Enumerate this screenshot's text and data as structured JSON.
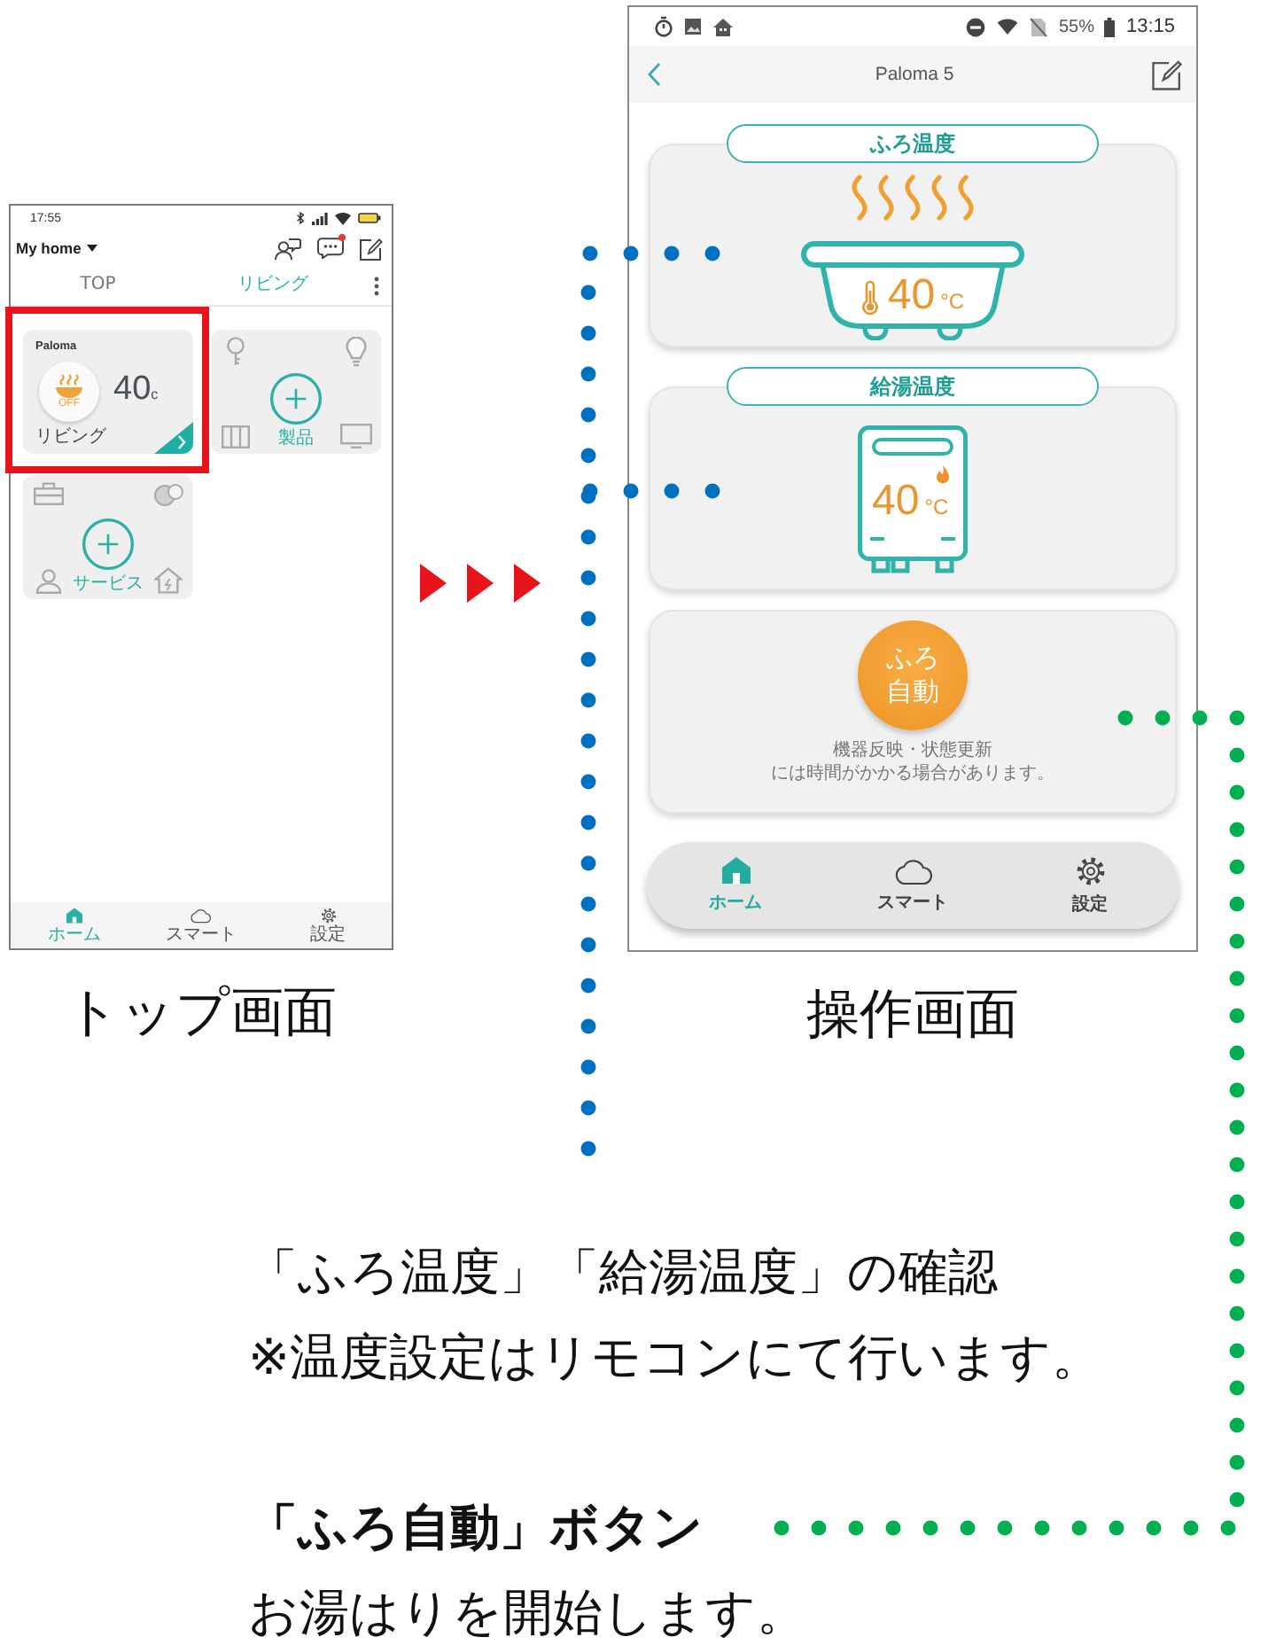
{
  "top_screen": {
    "status_bar": {
      "time": "17:55"
    },
    "header": {
      "home_name": "My home"
    },
    "tabs": [
      {
        "label": "TOP",
        "selected": false
      },
      {
        "label": "リビング",
        "selected": true
      }
    ],
    "cards": [
      {
        "kind": "device",
        "name": "Paloma",
        "state": "OFF",
        "temperature": "40",
        "unit": "c",
        "room": "リビング",
        "highlighted": true
      },
      {
        "kind": "products",
        "label": "製品",
        "highlighted": false
      },
      {
        "kind": "services",
        "label": "サービス",
        "highlighted": false
      }
    ],
    "nav": [
      {
        "label": "ホーム",
        "selected": true
      },
      {
        "label": "スマート",
        "selected": false
      },
      {
        "label": "設定",
        "selected": false
      }
    ],
    "caption": "トップ画面"
  },
  "control_screen": {
    "status_bar": {
      "battery": "55%",
      "time": "13:15"
    },
    "header": {
      "title": "Paloma 5"
    },
    "panels": [
      {
        "kind": "bath",
        "label": "ふろ温度",
        "temperature": "40",
        "unit": "°C"
      },
      {
        "kind": "heater",
        "label": "給湯温度",
        "temperature": "40",
        "unit": "°C"
      },
      {
        "kind": "button",
        "button": "ふろ自動",
        "note": [
          "機器反映・状態更新",
          "には時間がかかる場合があります。"
        ]
      }
    ],
    "nav": [
      {
        "label": "ホーム",
        "selected": true
      },
      {
        "label": "スマート",
        "selected": false
      },
      {
        "label": "設定",
        "selected": false
      }
    ],
    "caption": "操作画面"
  },
  "callouts": [
    {
      "color": "#0070c0",
      "heading": "「ふろ温度」「給湯温度」の確認",
      "text": "※温度設定はリモコンにて行います。",
      "bold": false
    },
    {
      "color": "#00b050",
      "heading": "「ふろ自動」ボタン",
      "text": "お湯はりを開始します。",
      "bold": true
    }
  ]
}
